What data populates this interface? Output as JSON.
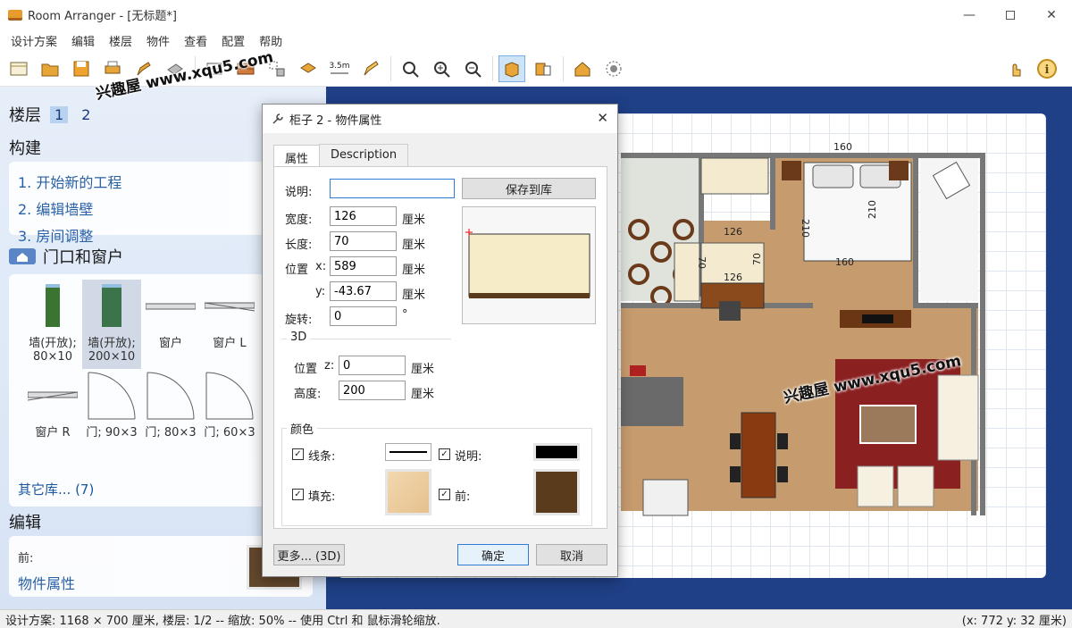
{
  "window": {
    "title": "Room Arranger - [无标题*]",
    "icons": {
      "app": "sofa-app-icon",
      "minimize": "minimize-icon",
      "maximize": "maximize-icon",
      "close": "close-icon"
    }
  },
  "menu": [
    "设计方案",
    "编辑",
    "楼层",
    "物件",
    "查看",
    "配置",
    "帮助"
  ],
  "toolbar": {
    "distance_label": "3.5m",
    "icons": [
      "new-icon",
      "open-icon",
      "save-icon",
      "print-icon",
      "pencil-icon",
      "stamp-icon",
      "wall-icon",
      "brick-icon",
      "snap-icon",
      "object-move-icon",
      "dimension-icon",
      "draw-icon",
      "zoom-fit-icon",
      "zoom-in-icon",
      "zoom-out-icon",
      "view-2d-icon",
      "view-3d-icon",
      "house-icon",
      "settings-icon",
      "hand-icon",
      "info-icon"
    ]
  },
  "watermark": "兴趣屋 www.xqu5.com",
  "sidebar": {
    "floor_label": "楼层",
    "floors": [
      "1",
      "2"
    ],
    "build_heading": "构建",
    "steps": [
      "1. 开始新的工程",
      "2. 编辑墙壁",
      "3. 房间调整"
    ],
    "doors_windows_heading": "门口和窗户",
    "library": [
      {
        "line1": "墙(开放);",
        "line2": "80×10"
      },
      {
        "line1": "墙(开放);",
        "line2": "200×10"
      },
      {
        "line1": "窗户",
        "line2": ""
      },
      {
        "line1": "窗户 L",
        "line2": ""
      },
      {
        "line1": "窗户 R",
        "line2": ""
      },
      {
        "line1": "门; 90×3",
        "line2": ""
      },
      {
        "line1": "门; 80×3",
        "line2": ""
      },
      {
        "line1": "门; 60×3",
        "line2": ""
      }
    ],
    "more_library": "其它库... (7)",
    "edit_heading": "编辑",
    "front_label": "前:",
    "object_props_link": "物件属性",
    "front_color": "#5a3b1c"
  },
  "plan": {
    "dims": [
      "160",
      "210",
      "210",
      "160",
      "126",
      "70",
      "70",
      "126"
    ]
  },
  "dialog": {
    "title": "柜子 2 - 物件属性",
    "tabs": [
      "属性",
      "Description"
    ],
    "description_label": "说明:",
    "description_value": "",
    "save_to_library": "保存到库",
    "width_label": "宽度:",
    "width_value": "126",
    "length_label": "长度:",
    "length_value": "70",
    "pos_label": "位置",
    "x_label": "x:",
    "x_value": "589",
    "y_label": "y:",
    "y_value": "-43.67",
    "rotation_label": "旋转:",
    "rotation_value": "0",
    "degree_unit": "°",
    "unit": "厘米",
    "section_3d": "3D",
    "pos_z_label": "位置",
    "z_label": "z:",
    "z_value": "0",
    "height_label": "高度:",
    "height_value": "200",
    "color_section": "颜色",
    "line_label": "线条:",
    "desc_color_label": "说明:",
    "fill_label": "填充:",
    "front_label": "前:",
    "front_color": "#5a3b1c",
    "desc_color": "#000000",
    "more_button": "更多... (3D)",
    "ok_button": "确定",
    "cancel_button": "取消"
  },
  "status": {
    "left": "设计方案: 1168 × 700 厘米, 楼层: 1/2 -- 缩放: 50% -- 使用 Ctrl 和 鼠标滑轮缩放.",
    "right": "(x: 772 y: 32 厘米)"
  }
}
